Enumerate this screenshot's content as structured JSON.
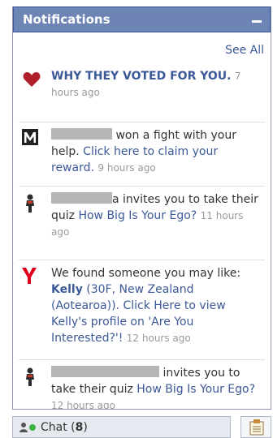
{
  "header": {
    "title": "Notifications"
  },
  "see_all": "See All",
  "notifications": [
    {
      "icon": "heart-icon",
      "title": "WHY THEY VOTED FOR YOU.",
      "time": "7 hours ago"
    },
    {
      "icon": "mafia-m-icon",
      "text_a": " won a fight with your help. ",
      "link": "Click here to claim your reward.",
      "time": "9 hours ago"
    },
    {
      "icon": "ego-figure-icon",
      "text_a": "a invites you to take their quiz ",
      "link": "How Big Is Your Ego?",
      "time": "11 hours ago"
    },
    {
      "icon": "yahoo-y-icon",
      "text_a": "We found someone you may like: ",
      "name": "Kelly",
      "link_a": " (30F, New Zealand (Aotearoa)). Click Here to view Kelly's profile on 'Are You Interested?'!",
      "time": "12 hours ago"
    },
    {
      "icon": "ego-figure-icon",
      "text_a": " invites you to take their quiz ",
      "link": "How Big Is Your Ego?",
      "time": "12 hours ago"
    }
  ],
  "chat": {
    "label": "Chat (",
    "count": "8",
    "close": ")"
  },
  "colors": {
    "header": "#6d84b4",
    "link": "#3b5998",
    "heart": "#b0202a",
    "yahoo": "#e0001b",
    "online": "#3cb340"
  }
}
